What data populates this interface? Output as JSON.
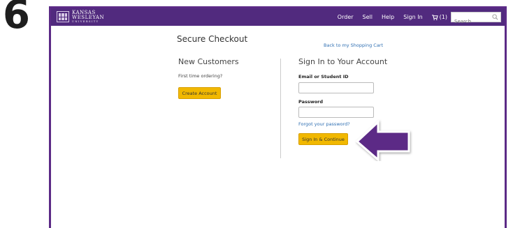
{
  "step_number": "6",
  "brand": {
    "line1": "KANSAS",
    "line2": "WESLEYAN",
    "line3": "UNIVERSITY"
  },
  "nav": {
    "links": [
      "Order",
      "Sell",
      "Help",
      "Sign In"
    ],
    "cart_label": "(1)",
    "search_placeholder": "Search"
  },
  "page": {
    "title": "Secure Checkout",
    "back_link": "Back to my Shopping Cart"
  },
  "new_customers": {
    "title": "New Customers",
    "prompt": "First time ordering?",
    "button": "Create Account"
  },
  "sign_in": {
    "title": "Sign In to Your Account",
    "email_label": "Email or Student ID",
    "password_label": "Password",
    "forgot_link": "Forgot your password?",
    "button": "Sign In & Continue"
  },
  "colors": {
    "brand_purple": "#512a7e",
    "button_gold": "#f1b800",
    "link_blue": "#2f6fb2",
    "arrow_purple": "#5b2a86"
  }
}
